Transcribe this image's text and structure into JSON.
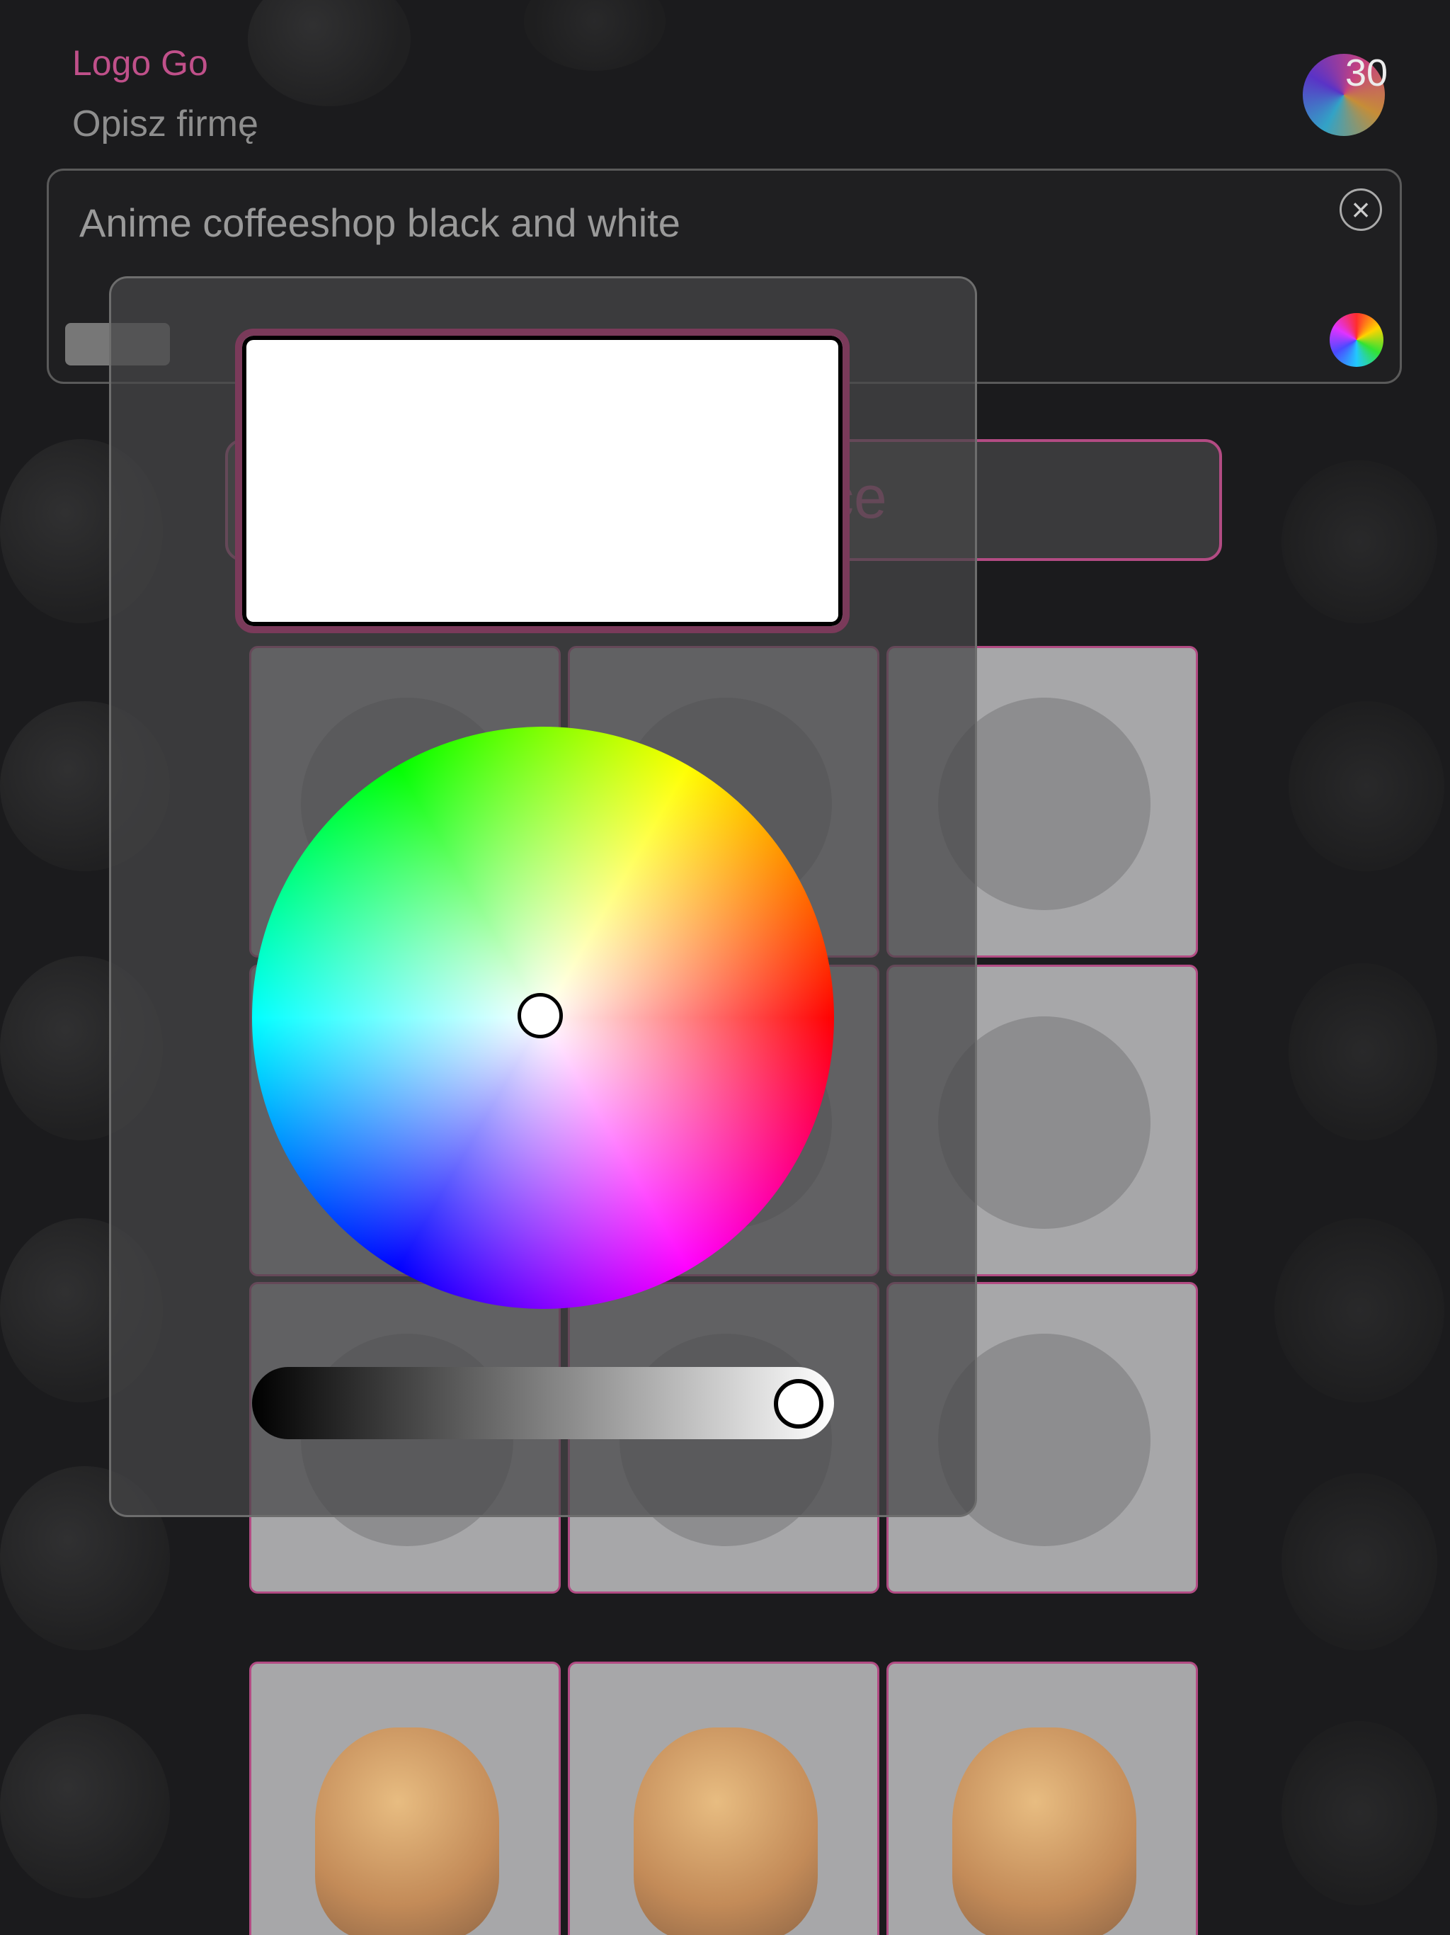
{
  "header": {
    "app_title": "Logo Go",
    "subtitle": "Opisz firmę",
    "credits": "30"
  },
  "prompt": {
    "value": "Anime coffeeshop black and white"
  },
  "generate_button": {
    "label_visible": "ce"
  },
  "color_picker": {
    "selected_color": "#ffffff",
    "brightness": 0.94
  },
  "tiles": [
    {
      "name": "logo-tile-1",
      "icon": "coffee-logo-icon"
    },
    {
      "name": "logo-tile-2",
      "icon": "anime-boy-icon"
    },
    {
      "name": "logo-tile-3",
      "icon": "coffee-cup-icon"
    },
    {
      "name": "logo-tile-4",
      "icon": "coffee-logo-icon"
    },
    {
      "name": "logo-tile-5",
      "icon": "anime-girl-icon"
    },
    {
      "name": "logo-tile-6",
      "icon": "coffee-cup-icon"
    },
    {
      "name": "logo-tile-7",
      "icon": "anime-girl-icon"
    },
    {
      "name": "logo-tile-8",
      "icon": "anime-girl-icon"
    },
    {
      "name": "logo-tile-9",
      "icon": "coffee-cup-icon"
    },
    {
      "name": "logo-tile-10",
      "icon": "puppy-shopping-icon"
    },
    {
      "name": "logo-tile-11",
      "icon": "puppy-shopping-icon"
    },
    {
      "name": "logo-tile-12",
      "icon": "puppy-shopping-icon"
    }
  ],
  "colors": {
    "accent": "#c0508a",
    "background": "#1b1b1d"
  }
}
